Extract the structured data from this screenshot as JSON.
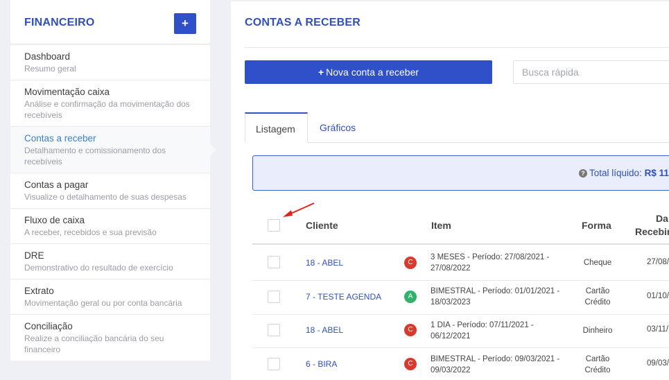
{
  "sidebar": {
    "title": "FINANCEIRO",
    "add_label": "+",
    "items": [
      {
        "title": "Dashboard",
        "subtitle": "Resumo geral"
      },
      {
        "title": "Movimentação caixa",
        "subtitle": "Análise e confirmação da movimentação dos recebíveis"
      },
      {
        "title": "Contas a receber",
        "subtitle": "Detalhamento e comissionamento dos recebíveis"
      },
      {
        "title": "Contas a pagar",
        "subtitle": "Visualize o detalhamento de suas despesas"
      },
      {
        "title": "Fluxo de caixa",
        "subtitle": "A receber, recebidos e sua previsão"
      },
      {
        "title": "DRE",
        "subtitle": "Demonstrativo do resultado de exercício"
      },
      {
        "title": "Extrato",
        "subtitle": "Movimentação geral ou por conta bancária"
      },
      {
        "title": "Conciliação",
        "subtitle": "Realize a conciliação bancária do seu financeiro"
      }
    ]
  },
  "main": {
    "title": "CONTAS A RECEBER",
    "new_button": "Nova conta a receber",
    "search_placeholder": "Busca rápida",
    "tabs": [
      "Listagem",
      "Gráficos"
    ],
    "total": {
      "icon": "?",
      "label": "Total líquido:",
      "value": "R$ 11"
    },
    "columns": {
      "cliente": "Cliente",
      "item": "Item",
      "forma": "Forma",
      "data_1": "Da",
      "data_2": "Recebim"
    },
    "rows": [
      {
        "cliente": "18 - ABEL",
        "badge": "C",
        "badge_color": "#d93a2b",
        "item_1": "3 MESES - Período: 27/08/2021 -",
        "item_2": "27/08/2022",
        "forma_1": "Cheque",
        "forma_2": "",
        "data": "27/08/"
      },
      {
        "cliente": "7 - TESTE AGENDA",
        "badge": "A",
        "badge_color": "#2fb36b",
        "item_1": "BIMESTRAL - Período: 01/01/2021 -",
        "item_2": "18/03/2023",
        "forma_1": "Cartão",
        "forma_2": "Crédito",
        "data": "01/10/"
      },
      {
        "cliente": "18 - ABEL",
        "badge": "C",
        "badge_color": "#d93a2b",
        "item_1": "1 DIA - Período: 07/11/2021 -",
        "item_2": "06/12/2021",
        "forma_1": "Dinheiro",
        "forma_2": "",
        "data": "03/11/"
      },
      {
        "cliente": "6 - BIRA",
        "badge": "C",
        "badge_color": "#d93a2b",
        "item_1": "BIMESTRAL - Período: 09/03/2021 -",
        "item_2": "09/03/2022",
        "forma_1": "Cartão",
        "forma_2": "Crédito",
        "data": "09/03/"
      }
    ]
  },
  "annotation": {
    "color": "#e0241b"
  }
}
